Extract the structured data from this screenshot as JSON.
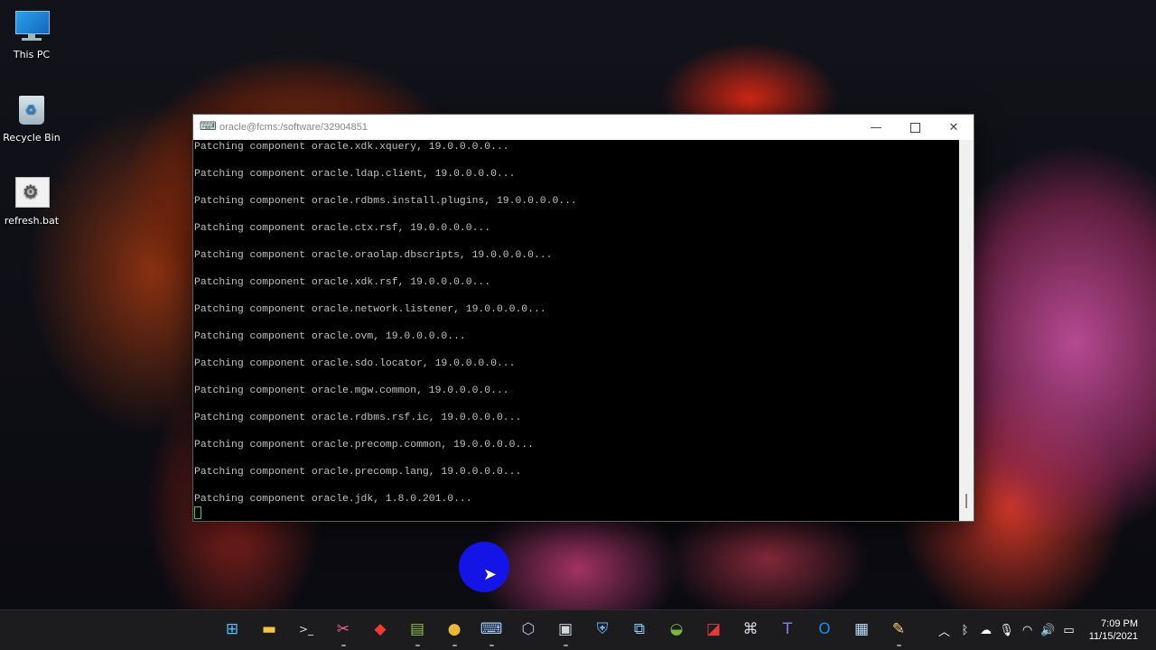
{
  "desktop": {
    "icons": [
      {
        "label": "This PC",
        "icon": "this-pc-icon"
      },
      {
        "label": "Recycle Bin",
        "icon": "recycle-bin-icon"
      },
      {
        "label": "refresh.bat",
        "icon": "batch-file-icon"
      }
    ]
  },
  "window": {
    "title": "oracle@fcms:/software/32904851",
    "icon": "putty-icon",
    "minimize_glyph": "—",
    "close_glyph": "✕"
  },
  "terminal": {
    "lines": [
      "Patching component oracle.xdk.xquery, 19.0.0.0.0...",
      "",
      "Patching component oracle.ldap.client, 19.0.0.0.0...",
      "",
      "Patching component oracle.rdbms.install.plugins, 19.0.0.0.0...",
      "",
      "Patching component oracle.ctx.rsf, 19.0.0.0.0...",
      "",
      "Patching component oracle.oraolap.dbscripts, 19.0.0.0.0...",
      "",
      "Patching component oracle.xdk.rsf, 19.0.0.0.0...",
      "",
      "Patching component oracle.network.listener, 19.0.0.0.0...",
      "",
      "Patching component oracle.ovm, 19.0.0.0.0...",
      "",
      "Patching component oracle.sdo.locator, 19.0.0.0.0...",
      "",
      "Patching component oracle.mgw.common, 19.0.0.0.0...",
      "",
      "Patching component oracle.rdbms.rsf.ic, 19.0.0.0.0...",
      "",
      "Patching component oracle.precomp.common, 19.0.0.0.0...",
      "",
      "Patching component oracle.precomp.lang, 19.0.0.0.0...",
      "",
      "Patching component oracle.jdk, 1.8.0.201.0..."
    ]
  },
  "taskbar": {
    "apps": [
      {
        "name": "start-icon",
        "glyph": "⊞",
        "color": "#4cc2ff",
        "running": false
      },
      {
        "name": "file-explorer-icon",
        "glyph": "▬",
        "color": "#f4c542",
        "running": false
      },
      {
        "name": "terminal-icon",
        "glyph": ">_",
        "color": "#dddddd",
        "running": false
      },
      {
        "name": "snipping-tool-icon",
        "glyph": "✂",
        "color": "#f06292",
        "running": true
      },
      {
        "name": "anydesk-icon",
        "glyph": "◆",
        "color": "#ef3b2d",
        "running": false
      },
      {
        "name": "notepad-icon",
        "glyph": "▤",
        "color": "#8bc34a",
        "running": true
      },
      {
        "name": "chrome-icon",
        "glyph": "●",
        "color": "#e8b93a",
        "running": true
      },
      {
        "name": "putty-icon",
        "glyph": "⌨",
        "color": "#9ec5ff",
        "running": true
      },
      {
        "name": "virtualbox-icon",
        "glyph": "⬡",
        "color": "#b0c4de",
        "running": false
      },
      {
        "name": "screen-recorder-icon",
        "glyph": "▣",
        "color": "#cfd8dc",
        "running": true
      },
      {
        "name": "defender-icon",
        "glyph": "⛨",
        "color": "#64b5f6",
        "running": false
      },
      {
        "name": "remote-desktop-icon",
        "glyph": "⧉",
        "color": "#90caf9",
        "running": false
      },
      {
        "name": "turtle-app-icon",
        "glyph": "◒",
        "color": "#7cb342",
        "running": false
      },
      {
        "name": "pdf-app-icon",
        "glyph": "◪",
        "color": "#e53935",
        "running": false
      },
      {
        "name": "network-app-icon",
        "glyph": "⌘",
        "color": "#cfd8dc",
        "running": false
      },
      {
        "name": "teams-icon",
        "glyph": "T",
        "color": "#7b83eb",
        "running": false
      },
      {
        "name": "outlook-icon",
        "glyph": "O",
        "color": "#1e88e5",
        "running": false
      },
      {
        "name": "performance-monitor-icon",
        "glyph": "▦",
        "color": "#bbdefb",
        "running": false
      },
      {
        "name": "paint-app-icon",
        "glyph": "✎",
        "color": "#ffcc80",
        "running": true
      }
    ],
    "tray": [
      {
        "name": "show-hidden-icons-icon",
        "glyph": "︿"
      },
      {
        "name": "bluetooth-icon",
        "glyph": "ᛒ"
      },
      {
        "name": "onedrive-icon",
        "glyph": "☁"
      },
      {
        "name": "microphone-icon",
        "glyph": "🎙"
      },
      {
        "name": "wifi-icon",
        "glyph": "◠"
      },
      {
        "name": "volume-icon",
        "glyph": "🔊"
      },
      {
        "name": "battery-icon",
        "glyph": "▭"
      }
    ],
    "clock": {
      "time": "7:09 PM",
      "date": "11/15/2021"
    }
  }
}
